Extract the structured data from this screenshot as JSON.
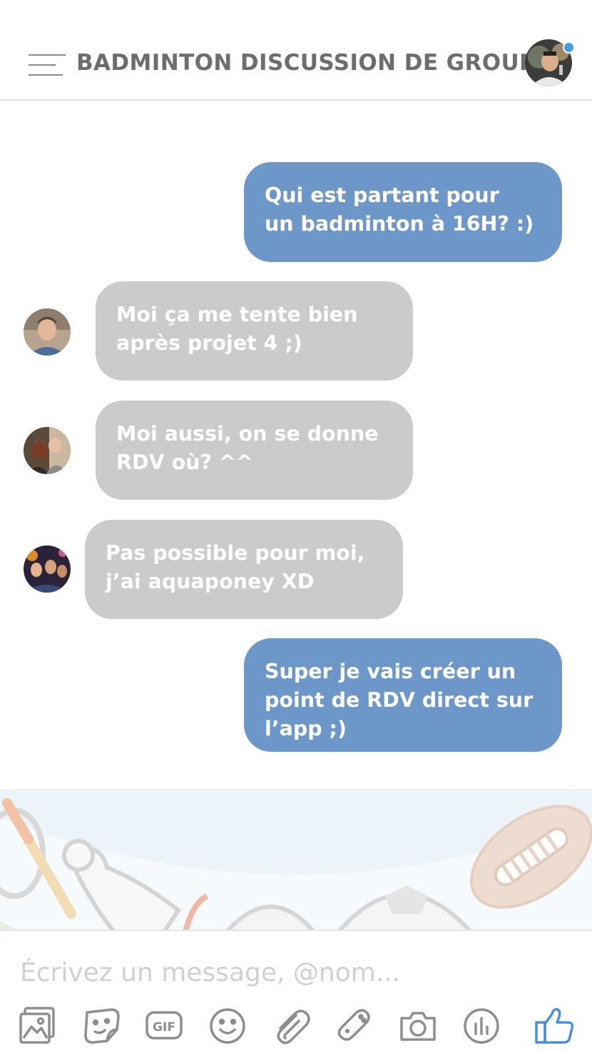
{
  "header": {
    "title": "BADMINTON DISCUSSION DE GROUPE"
  },
  "messages": [
    {
      "direction": "out",
      "text": "Qui est partant pour\nun badminton à 16H? :)"
    },
    {
      "direction": "in",
      "text": "Moi ça me tente bien\naprès projet 4 ;)"
    },
    {
      "direction": "in",
      "text": "Moi aussi, on se donne\nRDV où? ^^"
    },
    {
      "direction": "in",
      "text": "Pas possible pour moi,\nj’ai aquaponey XD"
    },
    {
      "direction": "out",
      "text": "Super je vais créer un\npoint de RDV direct sur\nl’app ;)"
    }
  ],
  "composer": {
    "placeholder": "Écrivez un message, @nom..."
  },
  "toolbar": {
    "icons": [
      "image-icon",
      "sticker-icon",
      "gif-icon",
      "emoji-icon",
      "attachment-icon",
      "game-controller-icon",
      "camera-icon",
      "poll-icon",
      "thumbs-up-icon"
    ]
  },
  "colors": {
    "outgoing_bubble": "#6d97c8",
    "incoming_bubble": "#cbcbcb",
    "accent": "#4a90d9"
  }
}
